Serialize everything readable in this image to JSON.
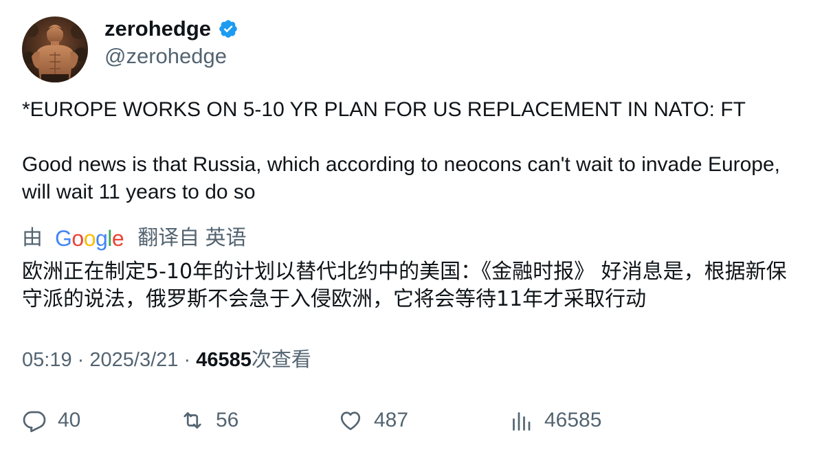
{
  "author": {
    "display_name": "zerohedge",
    "handle": "@zerohedge",
    "verified_badge_color": "#1d9bf0",
    "avatar_icon": "profile-photo"
  },
  "tweet": {
    "headline": "*EUROPE WORKS ON 5-10 YR PLAN FOR US REPLACEMENT IN NATO: FT",
    "body": "Good news is that Russia, which according to neocons can't wait to invade Europe, will wait 11 years to do so"
  },
  "translation": {
    "prefix": "由",
    "provider": "Google",
    "suffix": "翻译自 英语",
    "text": "欧洲正在制定5-10年的计划以替代北约中的美国：《金融时报》 好消息是，根据新保守派的说法，俄罗斯不会急于入侵欧洲，它将会等待11年才采取行动"
  },
  "meta": {
    "time": "05:19",
    "separator": "·",
    "date": "2025/3/21",
    "views": "46585",
    "views_label": "次查看"
  },
  "actions": {
    "replies": "40",
    "retweets": "56",
    "likes": "487",
    "views": "46585"
  },
  "colors": {
    "text": "#0f1419",
    "secondary": "#536471",
    "google_blue": "#4285F4",
    "google_red": "#EA4335",
    "google_yellow": "#FBBC05",
    "google_green": "#34A853"
  }
}
